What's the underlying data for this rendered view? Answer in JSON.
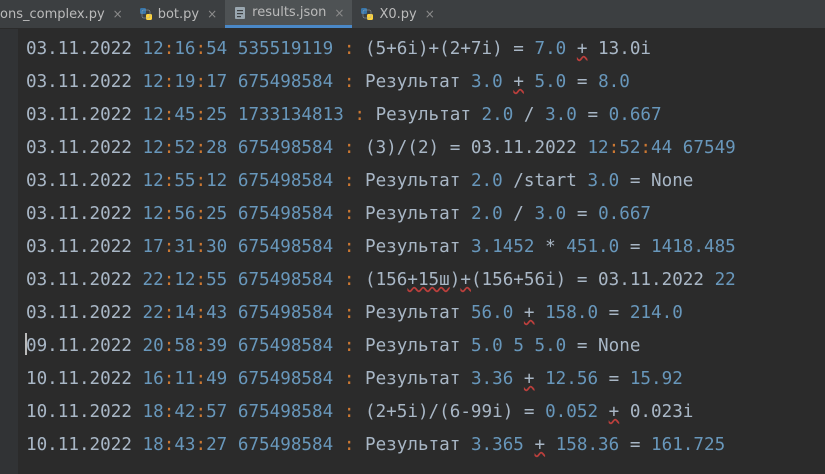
{
  "tabs": [
    {
      "label": "ons_complex.py",
      "icon": "python-file-icon",
      "active": false
    },
    {
      "label": "bot.py",
      "icon": "python-file-icon",
      "active": false
    },
    {
      "label": "results.json",
      "icon": "json-file-icon",
      "active": true
    },
    {
      "label": "X0.py",
      "icon": "python-file-icon",
      "active": false
    }
  ],
  "close_glyph": "×",
  "colors": {
    "background": "#2b2b2b",
    "number": "#6897bb",
    "colon": "#cc7832",
    "text": "#a9b7c6",
    "active_tab_underline": "#4a88c7"
  },
  "lines": [
    {
      "date": "03.11.2022",
      "h": "12",
      "m": "16",
      "s": "54",
      "id": "535519119",
      "body": [
        [
          "t",
          "(5+6i)+(2+7i) = "
        ],
        [
          "n",
          "7.0"
        ],
        [
          "t",
          " "
        ],
        [
          "u",
          "+"
        ],
        [
          "t",
          " 13.0i"
        ]
      ]
    },
    {
      "date": "03.11.2022",
      "h": "12",
      "m": "19",
      "s": "17",
      "id": "675498584",
      "body": [
        [
          "t",
          "Результат "
        ],
        [
          "n",
          "3.0"
        ],
        [
          "t",
          " "
        ],
        [
          "u",
          "+"
        ],
        [
          "t",
          " "
        ],
        [
          "n",
          "5.0"
        ],
        [
          "t",
          " = "
        ],
        [
          "n",
          "8.0"
        ]
      ]
    },
    {
      "date": "03.11.2022",
      "h": "12",
      "m": "45",
      "s": "25",
      "id": "1733134813",
      "body": [
        [
          "t",
          "Результат "
        ],
        [
          "n",
          "2.0"
        ],
        [
          "t",
          " / "
        ],
        [
          "n",
          "3.0"
        ],
        [
          "t",
          " = "
        ],
        [
          "n",
          "0.667"
        ]
      ]
    },
    {
      "date": "03.11.2022",
      "h": "12",
      "m": "52",
      "s": "28",
      "id": "675498584",
      "body": [
        [
          "t",
          "(3)/(2) = 03.11.2022 "
        ],
        [
          "n",
          "12"
        ],
        [
          "c",
          ":"
        ],
        [
          "n",
          "52"
        ],
        [
          "c",
          ":"
        ],
        [
          "n",
          "44"
        ],
        [
          "t",
          " "
        ],
        [
          "n",
          "67549"
        ]
      ]
    },
    {
      "date": "03.11.2022",
      "h": "12",
      "m": "55",
      "s": "12",
      "id": "675498584",
      "body": [
        [
          "t",
          "Результат "
        ],
        [
          "n",
          "2.0"
        ],
        [
          "t",
          " /start "
        ],
        [
          "n",
          "3.0"
        ],
        [
          "t",
          " = None"
        ]
      ]
    },
    {
      "date": "03.11.2022",
      "h": "12",
      "m": "56",
      "s": "25",
      "id": "675498584",
      "body": [
        [
          "t",
          "Результат "
        ],
        [
          "n",
          "2.0"
        ],
        [
          "t",
          " / "
        ],
        [
          "n",
          "3.0"
        ],
        [
          "t",
          " = "
        ],
        [
          "n",
          "0.667"
        ]
      ]
    },
    {
      "date": "03.11.2022",
      "h": "17",
      "m": "31",
      "s": "30",
      "id": "675498584",
      "body": [
        [
          "t",
          "Результат "
        ],
        [
          "n",
          "3.1452"
        ],
        [
          "t",
          " * "
        ],
        [
          "n",
          "451.0"
        ],
        [
          "t",
          " = "
        ],
        [
          "n",
          "1418.485"
        ]
      ]
    },
    {
      "date": "03.11.2022",
      "h": "22",
      "m": "12",
      "s": "55",
      "id": "675498584",
      "body": [
        [
          "t",
          "("
        ],
        [
          "t",
          "156"
        ],
        [
          "u",
          "+15ш"
        ],
        [
          "t",
          ")"
        ],
        [
          "u",
          "+"
        ],
        [
          "t",
          "(156+56i) = 03.11.2022 "
        ],
        [
          "n",
          "22"
        ]
      ]
    },
    {
      "date": "03.11.2022",
      "h": "22",
      "m": "14",
      "s": "43",
      "id": "675498584",
      "body": [
        [
          "t",
          "Результат "
        ],
        [
          "n",
          "56.0"
        ],
        [
          "t",
          " "
        ],
        [
          "u",
          "+"
        ],
        [
          "t",
          " "
        ],
        [
          "n",
          "158.0"
        ],
        [
          "t",
          " = "
        ],
        [
          "n",
          "214.0"
        ]
      ]
    },
    {
      "date": "09.11.2022",
      "h": "20",
      "m": "58",
      "s": "39",
      "id": "675498584",
      "body": [
        [
          "t",
          "Результат "
        ],
        [
          "n",
          "5.0"
        ],
        [
          "t",
          " "
        ],
        [
          "n",
          "5"
        ],
        [
          "t",
          " "
        ],
        [
          "n",
          "5.0"
        ],
        [
          "t",
          " = None"
        ]
      ]
    },
    {
      "date": "10.11.2022",
      "h": "16",
      "m": "11",
      "s": "49",
      "id": "675498584",
      "body": [
        [
          "t",
          "Результат "
        ],
        [
          "n",
          "3.36"
        ],
        [
          "t",
          " "
        ],
        [
          "u",
          "+"
        ],
        [
          "t",
          " "
        ],
        [
          "n",
          "12.56"
        ],
        [
          "t",
          " = "
        ],
        [
          "n",
          "15.92"
        ]
      ]
    },
    {
      "date": "10.11.2022",
      "h": "18",
      "m": "42",
      "s": "57",
      "id": "675498584",
      "body": [
        [
          "t",
          "(2+5i)/(6-99i) = "
        ],
        [
          "n",
          "0.052"
        ],
        [
          "t",
          " "
        ],
        [
          "u",
          "+"
        ],
        [
          "t",
          " 0.023i"
        ]
      ]
    },
    {
      "date": "10.11.2022",
      "h": "18",
      "m": "43",
      "s": "27",
      "id": "675498584",
      "body": [
        [
          "t",
          "Результат "
        ],
        [
          "n",
          "3.365"
        ],
        [
          "t",
          " "
        ],
        [
          "u",
          "+"
        ],
        [
          "t",
          " "
        ],
        [
          "n",
          "158.36"
        ],
        [
          "t",
          " = "
        ],
        [
          "n",
          "161.725"
        ]
      ]
    }
  ]
}
